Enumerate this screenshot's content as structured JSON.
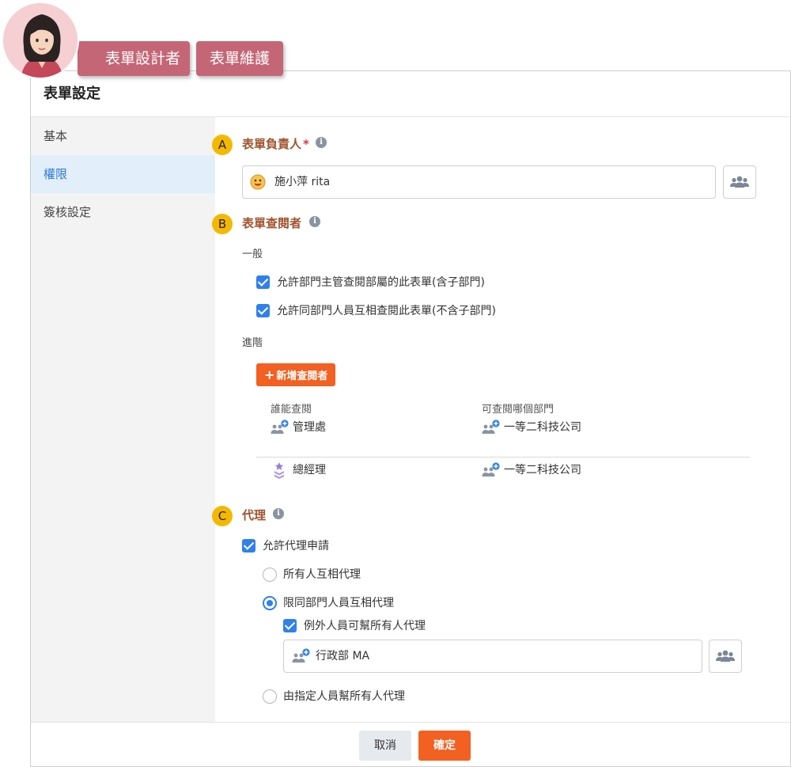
{
  "roles": [
    "表單設計者",
    "表單維護"
  ],
  "dialog": {
    "title": "表單設定",
    "sidebar": {
      "items": [
        {
          "label": "基本"
        },
        {
          "label": "權限"
        },
        {
          "label": "簽核設定"
        }
      ],
      "active": "權限"
    },
    "sections": {
      "owner": {
        "marker": "A",
        "title": "表單負責人",
        "required": "*",
        "value": "施小萍  rita"
      },
      "viewers": {
        "marker": "B",
        "title": "表單查閱者",
        "general_label": "一般",
        "general_options": [
          {
            "label": "允許部門主管查閱部屬的此表單(含子部門)",
            "checked": true
          },
          {
            "label": "允許同部門人員互相查閱此表單(不含子部門)",
            "checked": true
          }
        ],
        "advanced_label": "進階",
        "add_button": "新增查閱者",
        "table": {
          "headers": [
            "誰能查閱",
            "可查閱哪個部門"
          ],
          "rows": [
            {
              "who": "管理處",
              "who_icon": "department-icon",
              "dept": "一等二科技公司",
              "dept_icon": "department-icon"
            },
            {
              "who": "總經理",
              "who_icon": "position-rank-icon",
              "dept": "一等二科技公司",
              "dept_icon": "department-icon"
            }
          ]
        }
      },
      "delegate": {
        "marker": "C",
        "title": "代理",
        "allow_label": "允許代理申請",
        "allow_checked": true,
        "options": [
          {
            "label": "所有人互相代理",
            "selected": false
          },
          {
            "label": "限同部門人員互相代理",
            "selected": true
          },
          {
            "label": "由指定人員幫所有人代理",
            "selected": false
          }
        ],
        "exception_label": "例外人員可幫所有人代理",
        "exception_checked": true,
        "exception_value": "行政部  MA"
      }
    },
    "footer": {
      "cancel": "取消",
      "confirm": "確定"
    }
  },
  "colors": {
    "accent": "#f26022",
    "primary_blue": "#2f80ed",
    "role_tag": "#c46676",
    "section_title": "#a0522d",
    "marker": "#f5b800"
  }
}
